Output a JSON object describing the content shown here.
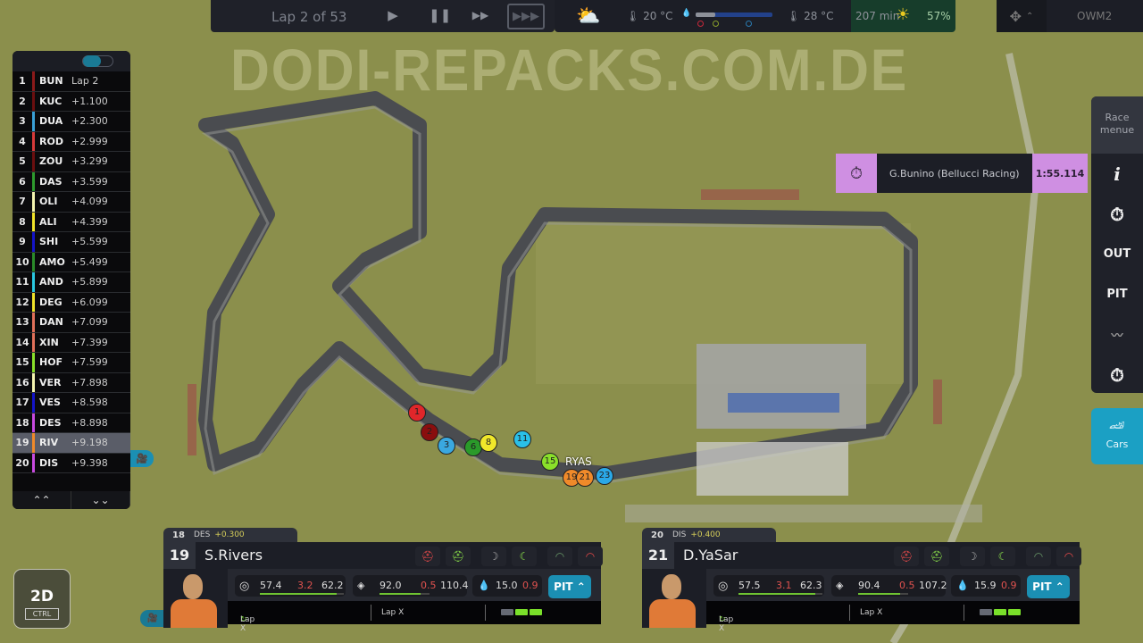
{
  "watermark": "DODI-REPACKS.COM.DE",
  "topbar": {
    "lap_text": "Lap 2 of 53",
    "play_icon": "play-icon",
    "pause_icon": "pause-icon",
    "fast_icon": "fast-forward-icon",
    "faster_icon": "fastest-forward-icon",
    "weather_icon": "partly-cloudy-icon",
    "air_temp": "20 °C",
    "track_temp": "28 °C",
    "track_wetness_percent": 25,
    "race_time": "207 min",
    "sun_icon": "sun-icon",
    "sun_percent": "57%",
    "settings_icon": "settings-gear-icon",
    "profile": "OWM2"
  },
  "standings": [
    {
      "pos": "1",
      "code": "BUN",
      "gap": "Lap 2",
      "color": "#8b1a1a"
    },
    {
      "pos": "2",
      "code": "KUC",
      "gap": "+1.100",
      "color": "#6b0f0f"
    },
    {
      "pos": "3",
      "code": "DUA",
      "gap": "+2.300",
      "color": "#3aa0d6"
    },
    {
      "pos": "4",
      "code": "ROD",
      "gap": "+2.999",
      "color": "#d63a3a"
    },
    {
      "pos": "5",
      "code": "ZOU",
      "gap": "+3.299",
      "color": "#6b0f0f"
    },
    {
      "pos": "6",
      "code": "DAS",
      "gap": "+3.599",
      "color": "#2e9a2e"
    },
    {
      "pos": "7",
      "code": "OLI",
      "gap": "+4.099",
      "color": "#f4f4b0"
    },
    {
      "pos": "8",
      "code": "ALI",
      "gap": "+4.399",
      "color": "#f0e32a"
    },
    {
      "pos": "9",
      "code": "SHI",
      "gap": "+5.599",
      "color": "#1414c8"
    },
    {
      "pos": "10",
      "code": "AMO",
      "gap": "+5.499",
      "color": "#2a8a2a"
    },
    {
      "pos": "11",
      "code": "AND",
      "gap": "+5.899",
      "color": "#2ac8e0"
    },
    {
      "pos": "12",
      "code": "DEG",
      "gap": "+6.099",
      "color": "#f0e32a"
    },
    {
      "pos": "13",
      "code": "DAN",
      "gap": "+7.099",
      "color": "#e0705a"
    },
    {
      "pos": "14",
      "code": "XIN",
      "gap": "+7.399",
      "color": "#e0705a"
    },
    {
      "pos": "15",
      "code": "HOF",
      "gap": "+7.599",
      "color": "#8ae02a"
    },
    {
      "pos": "16",
      "code": "VER",
      "gap": "+7.898",
      "color": "#f4f4b0"
    },
    {
      "pos": "17",
      "code": "VES",
      "gap": "+8.598",
      "color": "#1414c8"
    },
    {
      "pos": "18",
      "code": "DES",
      "gap": "+8.898",
      "color": "#c84ae0"
    },
    {
      "pos": "19",
      "code": "RIV",
      "gap": "+9.198",
      "color": "#f08a2a",
      "selected": true
    },
    {
      "pos": "20",
      "code": "DIS",
      "gap": "+9.398",
      "color": "#c84ae0"
    }
  ],
  "standings_footer": {
    "up": "⌃⌃",
    "down": "⌄⌄"
  },
  "fastest_lap": {
    "icon": "stopwatch-fastest-lap-icon",
    "driver": "G.Bunino (Bellucci Racing)",
    "time": "1:55.114"
  },
  "race_menu": {
    "title": "Race menue",
    "items": [
      {
        "label": "i",
        "icon": "info-icon"
      },
      {
        "label": "⏱",
        "icon": "stopwatch-icon"
      },
      {
        "label": "OUT",
        "icon": ""
      },
      {
        "label": "PIT",
        "icon": ""
      },
      {
        "label": "〰",
        "icon": "track-icon"
      },
      {
        "label": "⏱",
        "icon": "helmet-timer-icon"
      }
    ],
    "cars_label": "Cars"
  },
  "view_toggle": {
    "label": "2D",
    "key": "CTRL"
  },
  "map_cars": [
    {
      "num": "1",
      "color": "#e0262a"
    },
    {
      "num": "2",
      "color": "#8a0e0e"
    },
    {
      "num": "3",
      "color": "#3aa8e0"
    },
    {
      "num": "6",
      "color": "#2a9a2a"
    },
    {
      "num": "8",
      "color": "#f0e82a"
    },
    {
      "num": "11",
      "color": "#2ac0e8"
    },
    {
      "num": "15",
      "color": "#8ae02a"
    },
    {
      "num": "19",
      "color": "#f08a2a"
    },
    {
      "num": "21",
      "color": "#f08a2a"
    },
    {
      "num": "23",
      "color": "#2aa8e8"
    }
  ],
  "map_car_label": "RYAS",
  "drivers": [
    {
      "ahead_pos": "18",
      "ahead_code": "DES",
      "ahead_gap": "+0.300",
      "pos": "19",
      "name": "S.Rivers",
      "tyre": "57.4",
      "tyre_delta": "3.2",
      "tyre_max": "62.2",
      "tyre_fill": 0.92,
      "engine": "92.0",
      "engine_delta": "0.5",
      "engine_max": "110.4",
      "engine_fill": 0.83,
      "fuel": "15.0",
      "fuel_delta": "0.9",
      "pit": "PIT ⌃",
      "lap1": "Lap X",
      "lap2": "Lap X"
    },
    {
      "ahead_pos": "20",
      "ahead_code": "DIS",
      "ahead_gap": "+0.400",
      "pos": "21",
      "name": "D.YaSar",
      "tyre": "57.5",
      "tyre_delta": "3.1",
      "tyre_max": "62.3",
      "tyre_fill": 0.92,
      "engine": "90.4",
      "engine_delta": "0.5",
      "engine_max": "107.2",
      "engine_fill": 0.84,
      "fuel": "15.9",
      "fuel_delta": "0.9",
      "pit": "PIT ⌃",
      "lap1": "Lap X",
      "lap2": "Lap X"
    }
  ]
}
